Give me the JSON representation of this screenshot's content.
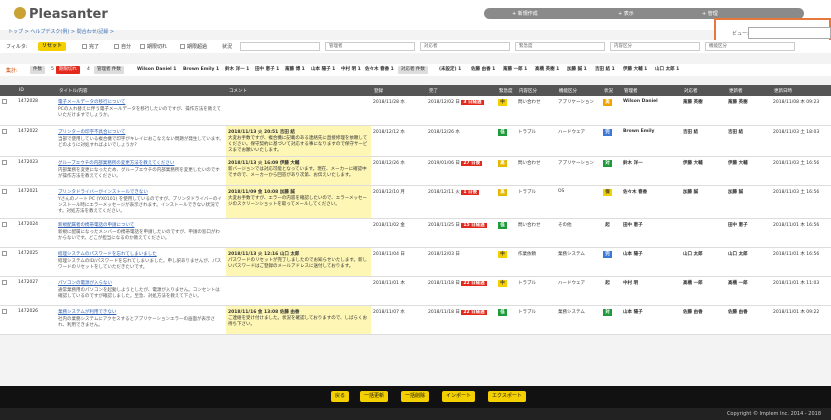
{
  "app": {
    "title": "Pleasanter"
  },
  "topnav": [
    "+ 新規作成",
    "+ 表示",
    "+ 管理"
  ],
  "breadcrumb": "トップ > ヘルプデスク(例) > 問合わせ/記録 >",
  "filter": {
    "label": "フィルタ:",
    "reset": "リセット",
    "opts": [
      "完了",
      "自分",
      "期限切れ",
      "期限超過",
      "状況"
    ],
    "selects": [
      "管理者",
      "対応者",
      "緊急度",
      "内容区分",
      "機能区分"
    ]
  },
  "view": {
    "label": "ビュー:"
  },
  "agg": {
    "label": "集計:",
    "items": [
      "件数",
      "5",
      "期限切れ",
      "4",
      "管理者 件数",
      "Wilson Daniel 1",
      "Brown Emily 1",
      "鈴木 洋一 1",
      "田中 恵子 1",
      "斎藤 博 1",
      "山本 陽子 1",
      "中村 明 1",
      "佐々木 春香 1",
      "対応者 件数",
      "(未設定) 1",
      "佐藤 由香 1",
      "斎藤 一郎 1",
      "高橋 英樹 1",
      "加藤 誠 1",
      "吉田 結 1",
      "伊藤 大輔 1",
      "山口 太郎 1"
    ]
  },
  "columns": [
    "",
    "ID",
    "タイトル/内容",
    "コメント",
    "登録",
    "完了",
    "緊急度",
    "内容区分",
    "機能区分",
    "状況",
    "管理者",
    "対応者",
    "更新者",
    "更新日時"
  ],
  "rows": [
    {
      "id": "1472028",
      "title": "電子メールデータの移行について",
      "body": "PCの入れ替えに伴う電子メールデータを移行したいのですが、操作方法を教えていただけますでしょうか。",
      "comment": "",
      "reg": "2018/11/28 水",
      "done": "2018/12/02 日",
      "late": "3 日経過",
      "pri": "中",
      "kind": "問い合わせ",
      "func": "アプリケーション",
      "stat": "実",
      "mgr": "Wilson Daniel",
      "op": "斎藤 英樹",
      "upd": "斎藤 英樹",
      "date": "2018/11/08 木 09:23"
    },
    {
      "id": "1472022",
      "title": "プリンターの印字不具合について",
      "body": "当部で使用している複合機で印字がキレイにおこなえない問題が発生しています。どのように対処すればよいでしょうか?",
      "comment_head": "2018/11/13 火 20:51 吉田 結",
      "comment": "大変お手数ですが、複合機に記載のある連絡先に直接修理を依頼してください。保守契約に基づいて対応する事になりますので保守サービスまでお願いいたします。",
      "reg": "2018/12/12 水",
      "done": "2018/12/26 水",
      "late": "",
      "pri": "低",
      "kind": "トラブル",
      "func": "ハードウェア",
      "stat": "完",
      "mgr": "Brown Emily",
      "op": "吉田 結",
      "upd": "吉田 結",
      "date": "2018/11/03 土 18:03"
    },
    {
      "id": "1472023",
      "title": "グループエウチの内部業務所の変更方法を教えてください",
      "body": "内部業務を変更になったため、グループエウチの内部業務所を変更したいのですが操作方法を教えてください。",
      "comment_head": "2018/11/13 火 16:09 伊藤 大輔",
      "comment": "新バージョンでは対応可能となっています。現在、メーカーに確認中ですので、メーカーから回答があり次第、お伝えいたします。",
      "reg": "2018/12/26 水",
      "done": "2019/01/06 日",
      "late": "27 日後",
      "pri": "高",
      "kind": "問い合わせ",
      "func": "アプリケーション",
      "stat": "対",
      "mgr": "鈴木 洋一",
      "op": "伊藤 大輔",
      "upd": "伊藤 大輔",
      "date": "2018/11/03 土 16:56"
    },
    {
      "id": "1472021",
      "title": "プリンタドライバーがインストールできない",
      "body": "Yさんのノート PC (YX0101) を使用しているのですが、プリンタドライバーのインストール時にエラーメッセージが表示されます。インストールできない状況です。対処方法を教えてください。",
      "comment_head": "2018/11/09 金 10:08 加藤 誠",
      "comment": "大変お手数ですが、エラーの内容を確認したいので、エラーメッセージのスクリーンショットを取ってメールしてください。",
      "reg": "2018/12/10 月",
      "done": "2018/12/11 火",
      "late": "1 日後",
      "pri": "高",
      "kind": "トラブル",
      "func": "OS",
      "stat": "保",
      "mgr": "佐々木 春香",
      "op": "加藤 誠",
      "upd": "加藤 誠",
      "date": "2018/11/03 土 16:56"
    },
    {
      "id": "1472024",
      "title": "新規配属者の携帯電話の申請について",
      "body": "新規に配属になったメンバーの携帯電話を申請したいのですが、申請の窓口がわからないです。どこが担当になるのか教えてください。",
      "comment": "",
      "reg": "2018/11/02 金",
      "done": "2018/11/25 日",
      "late": "15 日経過",
      "pri": "低",
      "kind": "問い合わせ",
      "func": "その他",
      "stat": "起",
      "mgr": "田中 恵子",
      "op": "",
      "upd": "田中 恵子",
      "date": "2018/11/01 木 16:56"
    },
    {
      "id": "1472025",
      "title": "経理システムのパスワードを忘れてしまいました",
      "body": "経理システムのID/パスワードを忘れてしまいました。申し訳ありませんが、パスワードのリセットをしていただきたいです。",
      "comment_head": "2018/11/13 火 12:16 山口 太郎",
      "comment": "パスワードのリセットが完了しましたのでお知らせいたします。新しいパスワードはご登録のメールアドレスに送付しております。",
      "reg": "2018/11/04 日",
      "done": "2018/12/03 日",
      "late": "",
      "pri": "中",
      "kind": "作業依頼",
      "func": "業務システム",
      "stat": "完",
      "mgr": "山本 陽子",
      "op": "山口 太郎",
      "upd": "山口 太郎",
      "date": "2018/11/01 木 16:56"
    },
    {
      "id": "1472027",
      "title": "パソコンの電源が入らない",
      "body": "通常業務用のパソコンを起動しようとしたが、電源が入りません。コンセントは確認しているのですが確認しました。至急、対処方法を教えて下さい。",
      "comment": "",
      "reg": "2018/11/01 木",
      "done": "2018/11/18 日",
      "late": "22 日経過",
      "pri": "中",
      "kind": "トラブル",
      "func": "ハードウェア",
      "stat": "起",
      "mgr": "中村 明",
      "op": "高橋 一郎",
      "upd": "高橋 一郎",
      "date": "2018/11/01 木 11:03"
    },
    {
      "id": "1472026",
      "title": "業務システムが利用できない",
      "body": "社内の業務システムにアクセスするとアプリケーションエラーの画面が表示され、利用できません。",
      "comment_head": "2018/11/16 金 13:08 佐藤 由香",
      "comment": "ご連絡を受け付けました。状況を確認しておりますので、しばらくお待ち下さい。",
      "reg": "2018/11/07 水",
      "done": "2018/11/18 日",
      "late": "22 日経過",
      "pri": "低",
      "kind": "トラブル",
      "func": "業務システム",
      "stat": "対",
      "mgr": "山本 陽子",
      "op": "佐藤 由香",
      "upd": "佐藤 由香",
      "date": "2018/11/01 木 09:22"
    }
  ],
  "footer": {
    "buttons": [
      "戻る",
      "一括更新",
      "一括削除",
      "インポート",
      "エクスポート"
    ],
    "copyright": "Copyright © Implem Inc. 2014 - 2018"
  }
}
